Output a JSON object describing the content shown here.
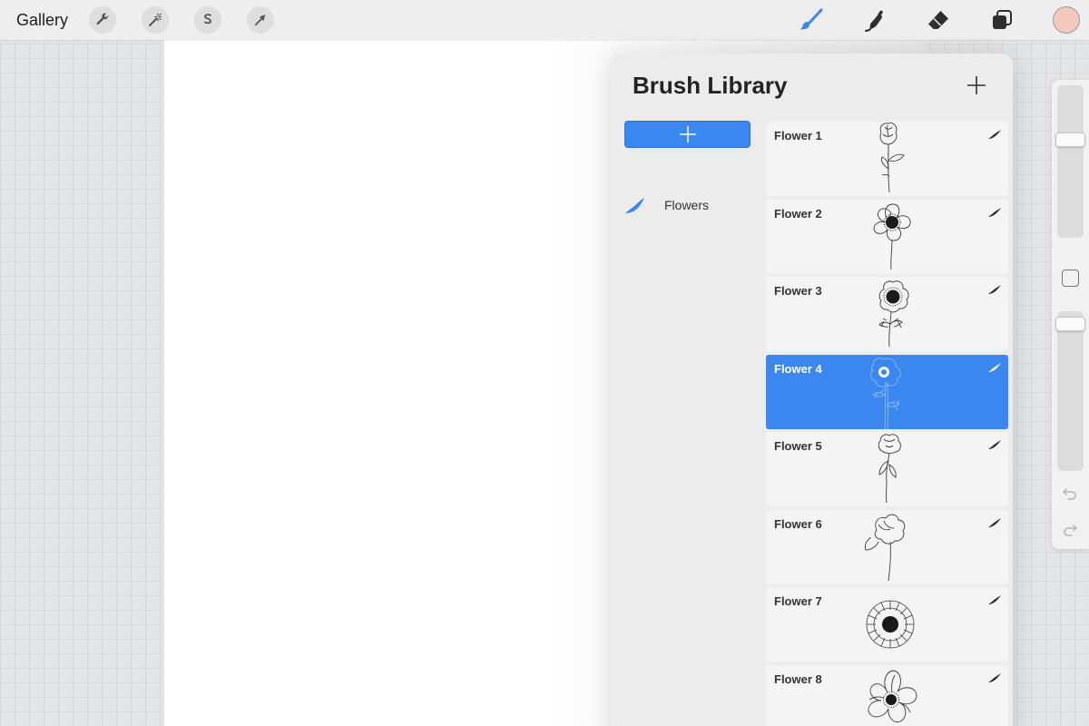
{
  "toolbar": {
    "gallery_label": "Gallery",
    "left_tools": [
      {
        "icon": "wrench-icon",
        "label": "Actions"
      },
      {
        "icon": "magic-wand-icon",
        "label": "Adjustments"
      },
      {
        "icon": "selection-icon",
        "label": "Selection"
      },
      {
        "icon": "transform-arrow-icon",
        "label": "Transform"
      }
    ],
    "right_tools": [
      {
        "icon": "paintbrush-icon",
        "active": true
      },
      {
        "icon": "smudge-icon",
        "active": false
      },
      {
        "icon": "eraser-icon",
        "active": false
      },
      {
        "icon": "layers-icon",
        "active": false
      }
    ],
    "current_color": "#f3c8bd",
    "accent_color": "#3a87f0"
  },
  "brush_library": {
    "title": "Brush Library",
    "sets": [
      {
        "name": "Flowers",
        "icon": "brush-stroke-icon",
        "selected": true
      }
    ],
    "brushes": [
      {
        "name": "Flower 1",
        "selected": false
      },
      {
        "name": "Flower 2",
        "selected": false
      },
      {
        "name": "Flower 3",
        "selected": false
      },
      {
        "name": "Flower 4",
        "selected": true
      },
      {
        "name": "Flower 5",
        "selected": false
      },
      {
        "name": "Flower 6",
        "selected": false
      },
      {
        "name": "Flower 7",
        "selected": false
      },
      {
        "name": "Flower 8",
        "selected": false
      }
    ]
  }
}
